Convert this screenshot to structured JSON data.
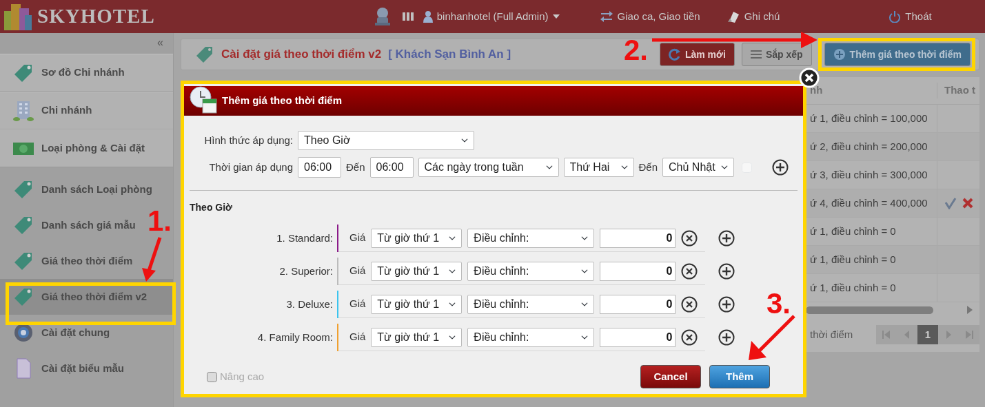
{
  "topbar": {
    "logo": "SKYHOTEL",
    "user": "binhanhotel (Full Admin)",
    "menu": [
      {
        "label": "Giao ca, Giao tiền"
      },
      {
        "label": "Ghi chú"
      },
      {
        "label": "Thoát"
      }
    ]
  },
  "sidebar": {
    "collapse": "«",
    "sections": [
      {
        "items": [
          {
            "label": "Sơ đồ Chi nhánh",
            "selected": false
          },
          {
            "label": "Chi nhánh",
            "selected": false
          },
          {
            "label": "Loại phòng & Cài đặt",
            "selected": false
          }
        ]
      },
      {
        "items": [
          {
            "label": "Danh sách Loại phòng",
            "selected": false
          },
          {
            "label": "Danh sách giá mẫu",
            "selected": false
          },
          {
            "label": "Giá theo thời điểm",
            "selected": false
          },
          {
            "label": "Giá theo thời điểm v2",
            "selected": true
          },
          {
            "label": "Cài đặt chung",
            "selected": false
          },
          {
            "label": "Cài đặt biểu mẫu",
            "selected": false
          }
        ]
      }
    ]
  },
  "page": {
    "title": "Cài đặt giá theo thời điểm v2",
    "hotel": "[ Khách Sạn Bình An ]",
    "buttons": [
      {
        "label": "Làm mới",
        "kind": "refresh"
      },
      {
        "label": "Sắp xếp",
        "kind": "sort"
      },
      {
        "label": "Thêm giá theo thời điểm",
        "kind": "add"
      }
    ]
  },
  "table": {
    "columns": [
      "nh",
      "Thao t"
    ],
    "rows": [
      {
        "cell": "ứ 1, điều chỉnh = 100,000",
        "actions": false
      },
      {
        "cell": "ứ 2, điều chỉnh = 200,000",
        "actions": false
      },
      {
        "cell": "ứ 3, điều chỉnh = 300,000",
        "actions": false
      },
      {
        "cell": "ứ 4, điều chỉnh = 400,000",
        "actions": true
      },
      {
        "cell": "ứ 1, điều chỉnh = 0",
        "actions": false
      },
      {
        "cell": "ứ 1, điều chỉnh = 0",
        "actions": false
      },
      {
        "cell": "ứ 1, điều chỉnh = 0",
        "actions": false
      }
    ],
    "footer": "thời điểm",
    "pages": [
      {
        "label": "1",
        "selected": true
      }
    ]
  },
  "dialog": {
    "title": "Thêm giá theo thời điểm",
    "mode": {
      "label": "Hình thức áp dụng:",
      "value": "Theo Giờ"
    },
    "time": {
      "label": "Thời gian áp dụng",
      "from": "06:00",
      "to_label": "Đến",
      "to": "06:00",
      "period": "Các ngày trong tuần",
      "day_from": "Thứ Hai",
      "day_to_label": "Đến",
      "day_to": "Chủ Nhật",
      "checked": false
    },
    "section": "Theo Giờ",
    "rooms": [
      {
        "label": "1. Standard:",
        "color": "#8b1a89",
        "price_label": "Giá",
        "from": "Từ giờ thứ 1",
        "adjust": "Điều chỉnh:",
        "value": "0"
      },
      {
        "label": "2. Superior:",
        "color": "#bbbbbb",
        "price_label": "Giá",
        "from": "Từ giờ thứ 1",
        "adjust": "Điều chỉnh:",
        "value": "0"
      },
      {
        "label": "3. Deluxe:",
        "color": "#3cc4ee",
        "price_label": "Giá",
        "from": "Từ giờ thứ 1",
        "adjust": "Điều chỉnh:",
        "value": "0"
      },
      {
        "label": "4. Family Room:",
        "color": "#f0a030",
        "price_label": "Giá",
        "from": "Từ giờ thứ 1",
        "adjust": "Điều chỉnh:",
        "value": "0"
      }
    ],
    "advanced": {
      "label": "Nâng cao",
      "checked": false,
      "disabled": true
    },
    "buttons": [
      {
        "label": "Cancel",
        "kind": "cancel"
      },
      {
        "label": "Thêm",
        "kind": "submit"
      }
    ]
  },
  "annotations": [
    {
      "label": "1."
    },
    {
      "label": "2."
    },
    {
      "label": "3."
    }
  ]
}
